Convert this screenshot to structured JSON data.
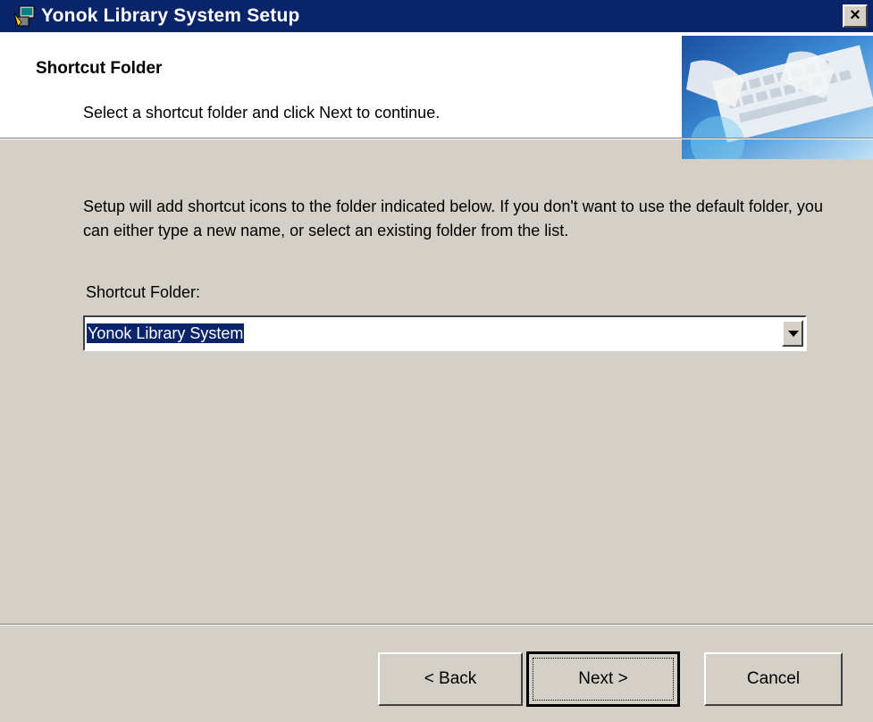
{
  "window": {
    "title": "Yonok Library System Setup",
    "close_label": "×",
    "title_icon": "setup-icon"
  },
  "header": {
    "title": "Shortcut Folder",
    "subtitle": "Select a shortcut folder and click Next to continue.",
    "image": "keyboard-typing-image"
  },
  "body": {
    "description": "Setup will add shortcut icons to the folder indicated below. If you don't want to use the default folder, you can either type a new name, or select an existing folder from the list.",
    "folder_label": "Shortcut Folder:",
    "folder_value": "Yonok Library System"
  },
  "buttons": {
    "back": "< Back",
    "next": "Next >",
    "cancel": "Cancel"
  },
  "colors": {
    "titlebar": "#0a246a",
    "dialog_bg": "#d4d0c8",
    "selection": "#0a246a"
  }
}
